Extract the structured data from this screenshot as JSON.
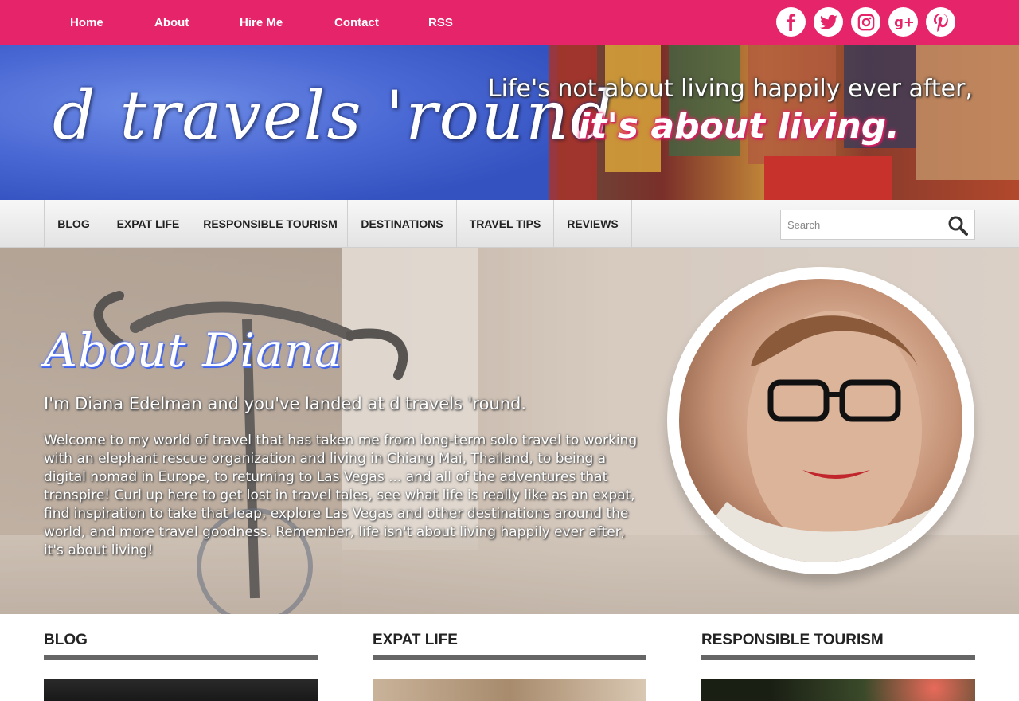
{
  "topnav": {
    "links": [
      "Home",
      "About",
      "Hire Me",
      "Contact",
      "RSS"
    ]
  },
  "social": {
    "icons": [
      "facebook-icon",
      "twitter-icon",
      "instagram-icon",
      "google-plus-icon",
      "pinterest-icon"
    ],
    "icon_color": "#e5246a"
  },
  "header": {
    "logo_text": "d travels 'round",
    "tagline_line1": "Life's not about living happily ever after,",
    "tagline_line2": "it's about living."
  },
  "mainnav": {
    "items": [
      "BLOG",
      "EXPAT LIFE",
      "RESPONSIBLE TOURISM",
      "DESTINATIONS",
      "TRAVEL TIPS",
      "REVIEWS"
    ]
  },
  "search": {
    "placeholder": "Search",
    "value": ""
  },
  "hero": {
    "title": "About Diana",
    "subtitle": "I'm Diana Edelman and you've landed at d travels 'round.",
    "body": "Welcome to my world of travel that has taken me from long-term solo travel to working with an elephant rescue organization and living in Chiang Mai, Thailand, to being a digital nomad in Europe, to returning to Las Vegas ... and all of the adventures that transpire! Curl up here to get lost in travel tales, see what life is really like as an expat, find inspiration to take that leap, explore Las Vegas and other destinations around the world, and more travel goodness. Remember, life isn't about living happily ever after, it's about living!"
  },
  "sections": [
    {
      "heading": "BLOG"
    },
    {
      "heading": "EXPAT LIFE"
    },
    {
      "heading": "RESPONSIBLE TOURISM"
    }
  ],
  "colors": {
    "accent": "#e5246a",
    "rule": "#666666",
    "title_glow": "#3d5fe0"
  }
}
